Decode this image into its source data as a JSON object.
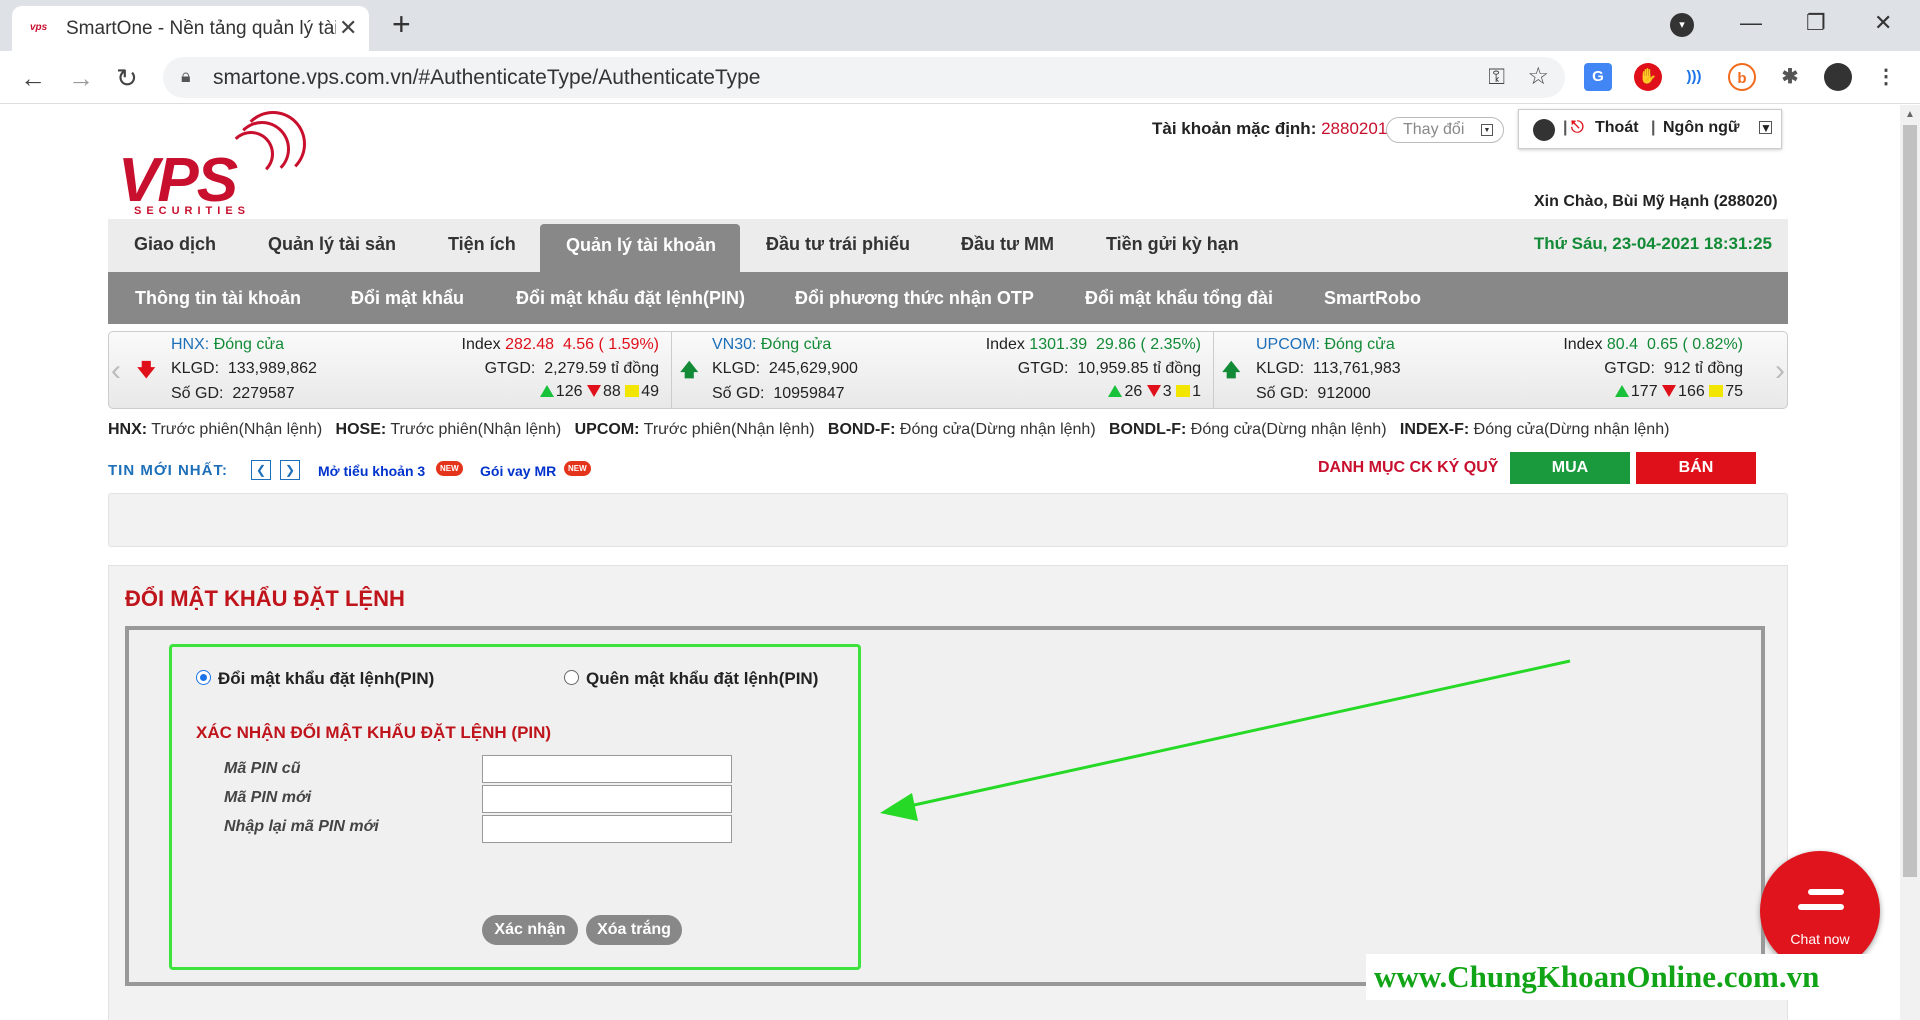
{
  "browser": {
    "tab_title": "SmartOne - Nền tảng quản lý tài",
    "favicon": "vps",
    "url": "smartone.vps.com.vn/#AuthenticateType/AuthenticateType"
  },
  "header": {
    "account_label": "Tài khoản mặc định:",
    "account_number": "2880201",
    "change_label": "Thay đổi",
    "logout": "Thoát",
    "language": "Ngôn ngữ",
    "greeting": "Xin Chào, Bùi Mỹ Hạnh (288020)",
    "logo_text": "VPS",
    "logo_sub": "SECURITIES"
  },
  "main_nav": {
    "items": [
      "Giao dịch",
      "Quản lý tài sản",
      "Tiện ích",
      "Quản lý tài khoản",
      "Đầu tư trái phiếu",
      "Đầu tư MM",
      "Tiền gửi kỳ hạn"
    ],
    "date": "Thứ Sáu, 23-04-2021 18:31:25"
  },
  "sub_nav": {
    "items": [
      "Thông tin tài khoản",
      "Đổi mật khẩu",
      "Đổi mật khẩu đặt lệnh(PIN)",
      "Đổi phương thức nhận OTP",
      "Đổi mật khẩu tổng đài",
      "SmartRobo"
    ]
  },
  "ticker": [
    {
      "name": "HNX:",
      "status": "Đóng cửa",
      "index_label": "Index",
      "index": "282.48",
      "change": "4.56",
      "pct": "( 1.59%)",
      "klgd_label": "KLGD:",
      "klgd": "133,989,862",
      "gtgd_label": "GTGD:",
      "gtgd": "2,279.59 tỉ đồng",
      "sogd_label": "Số GD:",
      "sogd": "2279587",
      "up": "126",
      "down": "88",
      "same": "49",
      "dir": "down"
    },
    {
      "name": "VN30:",
      "status": "Đóng cửa",
      "index_label": "Index",
      "index": "1301.39",
      "change": "29.86",
      "pct": "( 2.35%)",
      "klgd_label": "KLGD:",
      "klgd": "245,629,900",
      "gtgd_label": "GTGD:",
      "gtgd": "10,959.85 tỉ đồng",
      "sogd_label": "Số GD:",
      "sogd": "10959847",
      "up": "26",
      "down": "3",
      "same": "1",
      "dir": "up"
    },
    {
      "name": "UPCOM:",
      "status": "Đóng cửa",
      "index_label": "Index",
      "index": "80.4",
      "change": "0.65",
      "pct": "( 0.82%)",
      "klgd_label": "KLGD:",
      "klgd": "113,761,983",
      "gtgd_label": "GTGD:",
      "gtgd": "912 tỉ đồng",
      "sogd_label": "Số GD:",
      "sogd": "912000",
      "up": "177",
      "down": "166",
      "same": "75",
      "dir": "up"
    }
  ],
  "market_status": [
    {
      "k": "HNX:",
      "v": "Trước phiên(Nhận lệnh)"
    },
    {
      "k": "HOSE:",
      "v": "Trước phiên(Nhận lệnh)"
    },
    {
      "k": "UPCOM:",
      "v": "Trước phiên(Nhận lệnh)"
    },
    {
      "k": "BOND-F:",
      "v": "Đóng cửa(Dừng nhận lệnh)"
    },
    {
      "k": "BONDL-F:",
      "v": "Đóng cửa(Dừng nhận lệnh)"
    },
    {
      "k": "INDEX-F:",
      "v": "Đóng cửa(Dừng nhận lệnh)"
    }
  ],
  "news": {
    "label": "TIN MỚI NHẤT:",
    "links": [
      "Mở tiểu khoản 3",
      "Gói vay MR"
    ],
    "badge": "NEW"
  },
  "margin": {
    "label": "DANH MỤC CK KÝ QUỸ",
    "buy": "MUA",
    "sell": "BÁN"
  },
  "form": {
    "title": "ĐỔI MẬT KHẨU ĐẶT LỆNH",
    "option_change": "Đổi mật khẩu đặt lệnh(PIN)",
    "option_forgot": "Quên mật khẩu đặt lệnh(PIN)",
    "section_title": "XÁC NHẬN ĐỔI MẬT KHẨU ĐẶT LỆNH (PIN)",
    "old_pin": "Mã PIN cũ",
    "new_pin": "Mã PIN mới",
    "confirm_pin": "Nhập lại mã PIN mới",
    "submit": "Xác nhận",
    "clear": "Xóa trắng"
  },
  "chat": {
    "label": "Chat now"
  },
  "watermark": "www.ChungKhoanOnline.com.vn",
  "colors": {
    "brand_red": "#c8102e",
    "green": "#138a36",
    "buy": "#1a9a3d",
    "sell": "#e0101b",
    "highlight": "#3de23d"
  }
}
